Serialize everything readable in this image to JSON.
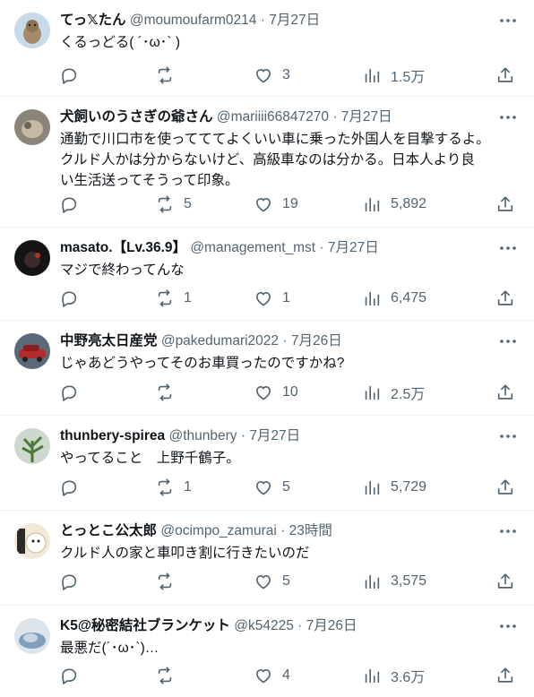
{
  "colors": {
    "text": "#0f1419",
    "muted": "#536471",
    "divider": "#eff3f4"
  },
  "posts": [
    {
      "name": "てっ𝕏たん",
      "handle": "@moumoufarm0214",
      "dot": "·",
      "time": "7月27日",
      "text": "くるっどる( ´･ω･` )",
      "replies": "",
      "retweets": "",
      "likes": "3",
      "views": "1.5万",
      "avatar": "cat-avatar"
    },
    {
      "name": "犬飼いのうさぎの爺さん",
      "handle": "@mariiii66847270",
      "dot": "·",
      "time": "7月27日",
      "text": "通勤で川口市を使ってててよくいい車に乗った外国人を目撃するよ。\nクルド人かは分からないけど、高級車なのは分かる。日本人より良\nい生活送ってそうって印象。",
      "replies": "",
      "retweets": "5",
      "likes": "19",
      "views": "5,892",
      "avatar": "rabbit-avatar"
    },
    {
      "name": "masato.【Lv.36.9】",
      "handle": "@management_mst",
      "dot": "·",
      "time": "7月27日",
      "text": "マジで終わってんな",
      "replies": "",
      "retweets": "1",
      "likes": "1",
      "views": "6,475",
      "avatar": "dark-avatar"
    },
    {
      "name": "中野亮太日産党",
      "handle": "@pakedumari2022",
      "dot": "·",
      "time": "7月26日",
      "text": "じゃあどうやってそのお車買ったのですかね?",
      "replies": "",
      "retweets": "",
      "likes": "10",
      "views": "2.5万",
      "avatar": "car-avatar"
    },
    {
      "name": "thunbery-spirea",
      "handle": "@thunbery",
      "dot": "·",
      "time": "7月27日",
      "text": "やってること　上野千鶴子。",
      "replies": "",
      "retweets": "1",
      "likes": "5",
      "views": "5,729",
      "avatar": "plant-avatar"
    },
    {
      "name": "とっとこ公太郎",
      "handle": "@ocimpo_zamurai",
      "dot": "·",
      "time": "23時間",
      "text": "クルド人の家と車叩き割に行きたいのだ",
      "replies": "",
      "retweets": "",
      "likes": "5",
      "views": "3,575",
      "avatar": "character-avatar"
    },
    {
      "name": "K5@秘密結社ブランケット",
      "handle": "@k54225",
      "dot": "·",
      "time": "7月26日",
      "text": "最悪だ(´･ω･`)…",
      "replies": "",
      "retweets": "",
      "likes": "4",
      "views": "3.6万",
      "avatar": "blanket-avatar"
    }
  ]
}
